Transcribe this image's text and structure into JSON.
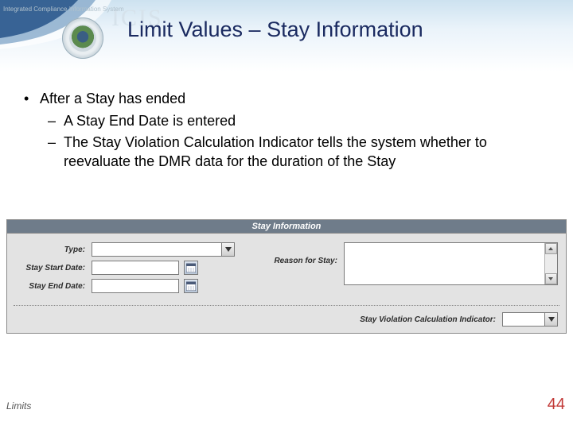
{
  "header": {
    "watermark": "ICIS",
    "watermark_sub": "Integrated Compliance Information System"
  },
  "title": "Limit Values – Stay Information",
  "bullets": {
    "main": "After a Stay has ended",
    "sub1": "A Stay End Date is entered",
    "sub2": "The Stay Violation Calculation Indicator tells the system whether to reevaluate the DMR data for the duration of the Stay"
  },
  "form": {
    "panel_title": "Stay Information",
    "labels": {
      "type": "Type:",
      "start": "Stay Start Date:",
      "end": "Stay End Date:",
      "reason": "Reason for Stay:",
      "indicator": "Stay Violation Calculation Indicator:"
    },
    "values": {
      "type": "",
      "start": "",
      "end": "",
      "reason": "",
      "indicator": ""
    }
  },
  "footer": {
    "section": "Limits",
    "page": "44"
  }
}
